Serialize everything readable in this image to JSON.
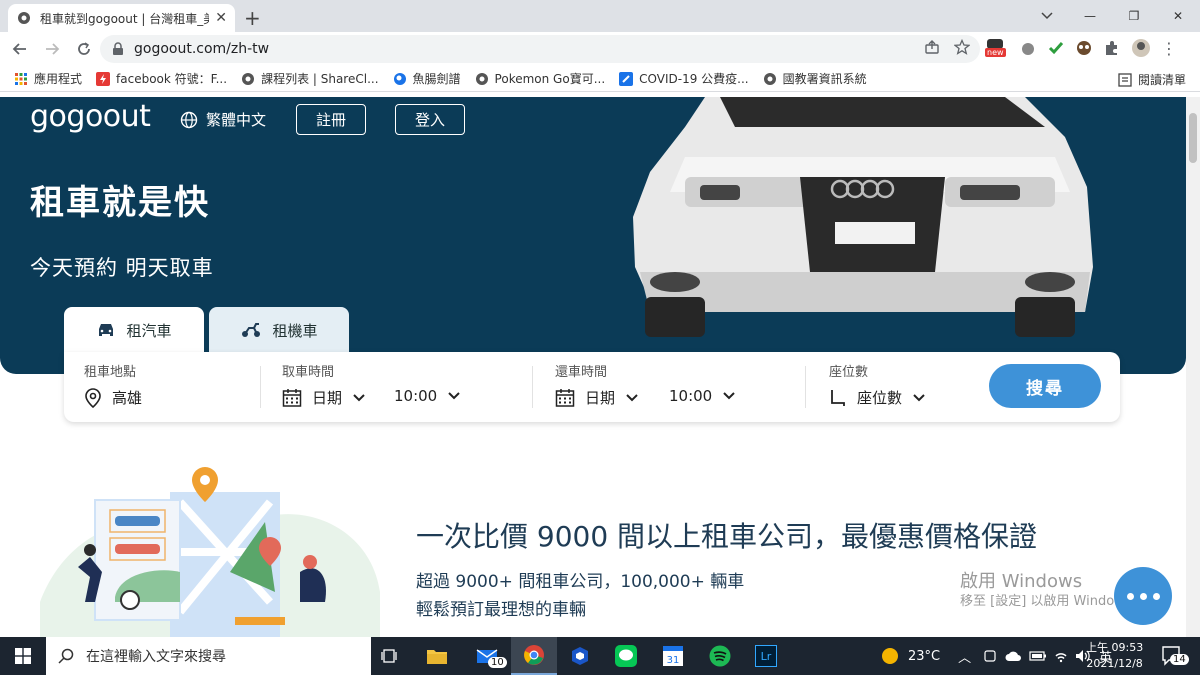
{
  "browser": {
    "tab_title": "租車就到gogoout | 台灣租車_美",
    "url": "gogoout.com/zh-tw",
    "ext_badge": "new",
    "bookmarks": [
      {
        "label": "應用程式",
        "icon": "apps-grid-icon",
        "color": "#e0542e"
      },
      {
        "label": "facebook 符號：F...",
        "icon": "bookmark-app-icon",
        "color": "#e53935"
      },
      {
        "label": "課程列表 | ShareCl...",
        "icon": "globe-icon",
        "color": "#555555"
      },
      {
        "label": "魚腸劍譜",
        "icon": "bookmark-round-icon",
        "color": "#1a73e8"
      },
      {
        "label": "Pokemon Go寶可...",
        "icon": "globe-icon",
        "color": "#555555"
      },
      {
        "label": "COVID-19 公費疫...",
        "icon": "bookmark-shield-icon",
        "color": "#1a73e8"
      },
      {
        "label": "國教署資訊系統",
        "icon": "globe-icon",
        "color": "#555555"
      }
    ],
    "reading_list": "閱讀清單"
  },
  "header": {
    "logo": "gogoout",
    "language": "繁體中文",
    "register": "註冊",
    "login": "登入"
  },
  "hero": {
    "title": "租車就是快",
    "subtitle": "今天預約 明天取車"
  },
  "vehicle_tabs": [
    {
      "label": "租汽車",
      "icon": "car-icon",
      "active": true
    },
    {
      "label": "租機車",
      "icon": "scooter-icon",
      "active": false
    }
  ],
  "search": {
    "location_label": "租車地點",
    "location_value": "高雄",
    "pickup_label": "取車時間",
    "pickup_date": "日期",
    "pickup_time": "10:00",
    "return_label": "還車時間",
    "return_date": "日期",
    "return_time": "10:00",
    "seats_label": "座位數",
    "seats_value": "座位數",
    "button": "搜尋"
  },
  "promo": {
    "headline": "一次比價 9000 間以上租車公司，最優惠價格保證",
    "line1": "超過 9000+ 間租車公司，100,000+ 輛車",
    "line2": "輕鬆預訂最理想的車輛"
  },
  "watermark": {
    "line1": "啟用 Windows",
    "line2": "移至 [設定] 以啟用 Windows。"
  },
  "taskbar": {
    "search_placeholder": "在這裡輸入文字來搜尋",
    "mail_badge": "10",
    "calendar_day": "31",
    "lr_label": "Lr",
    "weather": "23°C",
    "ime": "英",
    "time_line1": "上午 09:53",
    "time_line2": "2021/12/8",
    "notifications": "14"
  },
  "colors": {
    "hero_bg": "#0b3b57",
    "accent": "#3e92d8",
    "tab_inactive": "#e4eef4"
  }
}
